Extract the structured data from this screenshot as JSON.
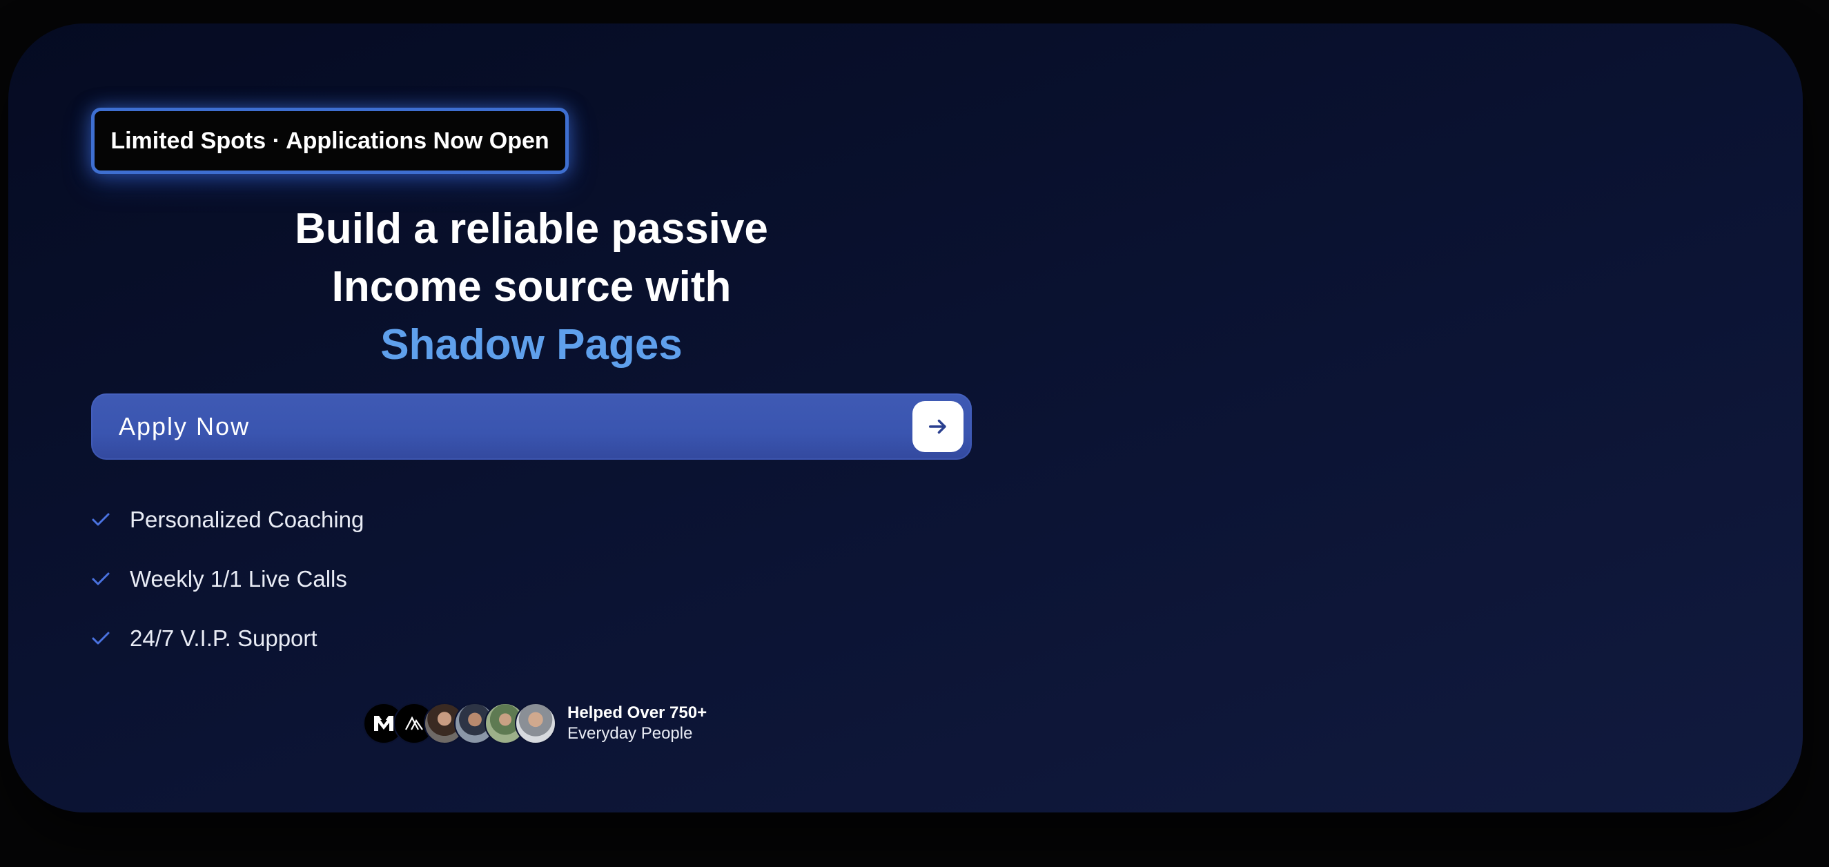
{
  "badge": {
    "text": "Limited Spots · Applications Now Open"
  },
  "hero": {
    "line1": "Build a reliable passive",
    "line2": "Income source with",
    "accent": "Shadow Pages",
    "accent_color": "#5fa0ec"
  },
  "cta": {
    "label": "Apply Now",
    "icon": "arrow-right-icon"
  },
  "features": [
    {
      "label": "Personalized Coaching",
      "icon": "check-icon"
    },
    {
      "label": "Weekly 1/1 Live Calls",
      "icon": "check-icon"
    },
    {
      "label": "24/7 V.I.P. Support",
      "icon": "check-icon"
    }
  ],
  "social_proof": {
    "title": "Helped Over 750+",
    "subtitle": "Everyday People",
    "avatars": [
      "logo-mm",
      "logo-a",
      "person-1",
      "person-2",
      "person-3",
      "person-4"
    ]
  },
  "colors": {
    "background": "#050506",
    "card": "#0b1333",
    "badge_border": "#3e6fd1",
    "cta": "#3a55b0",
    "check": "#4a72e0"
  }
}
